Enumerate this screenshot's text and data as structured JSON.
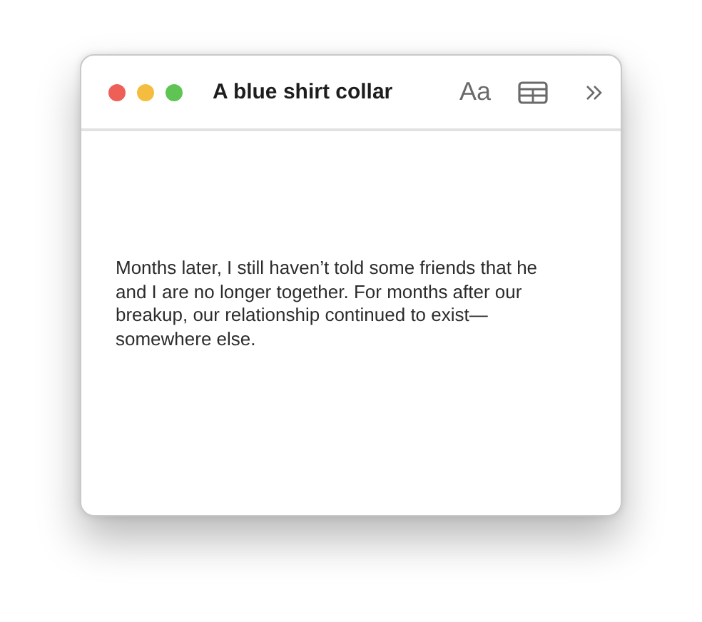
{
  "window": {
    "title": "A blue shirt collar"
  },
  "toolbar": {
    "font_button": "Aa"
  },
  "note": {
    "body": "Months later, I still haven’t told some friends that he and I are no longer together. For months after our breakup, our relationship continued to exist—somewhere else."
  }
}
